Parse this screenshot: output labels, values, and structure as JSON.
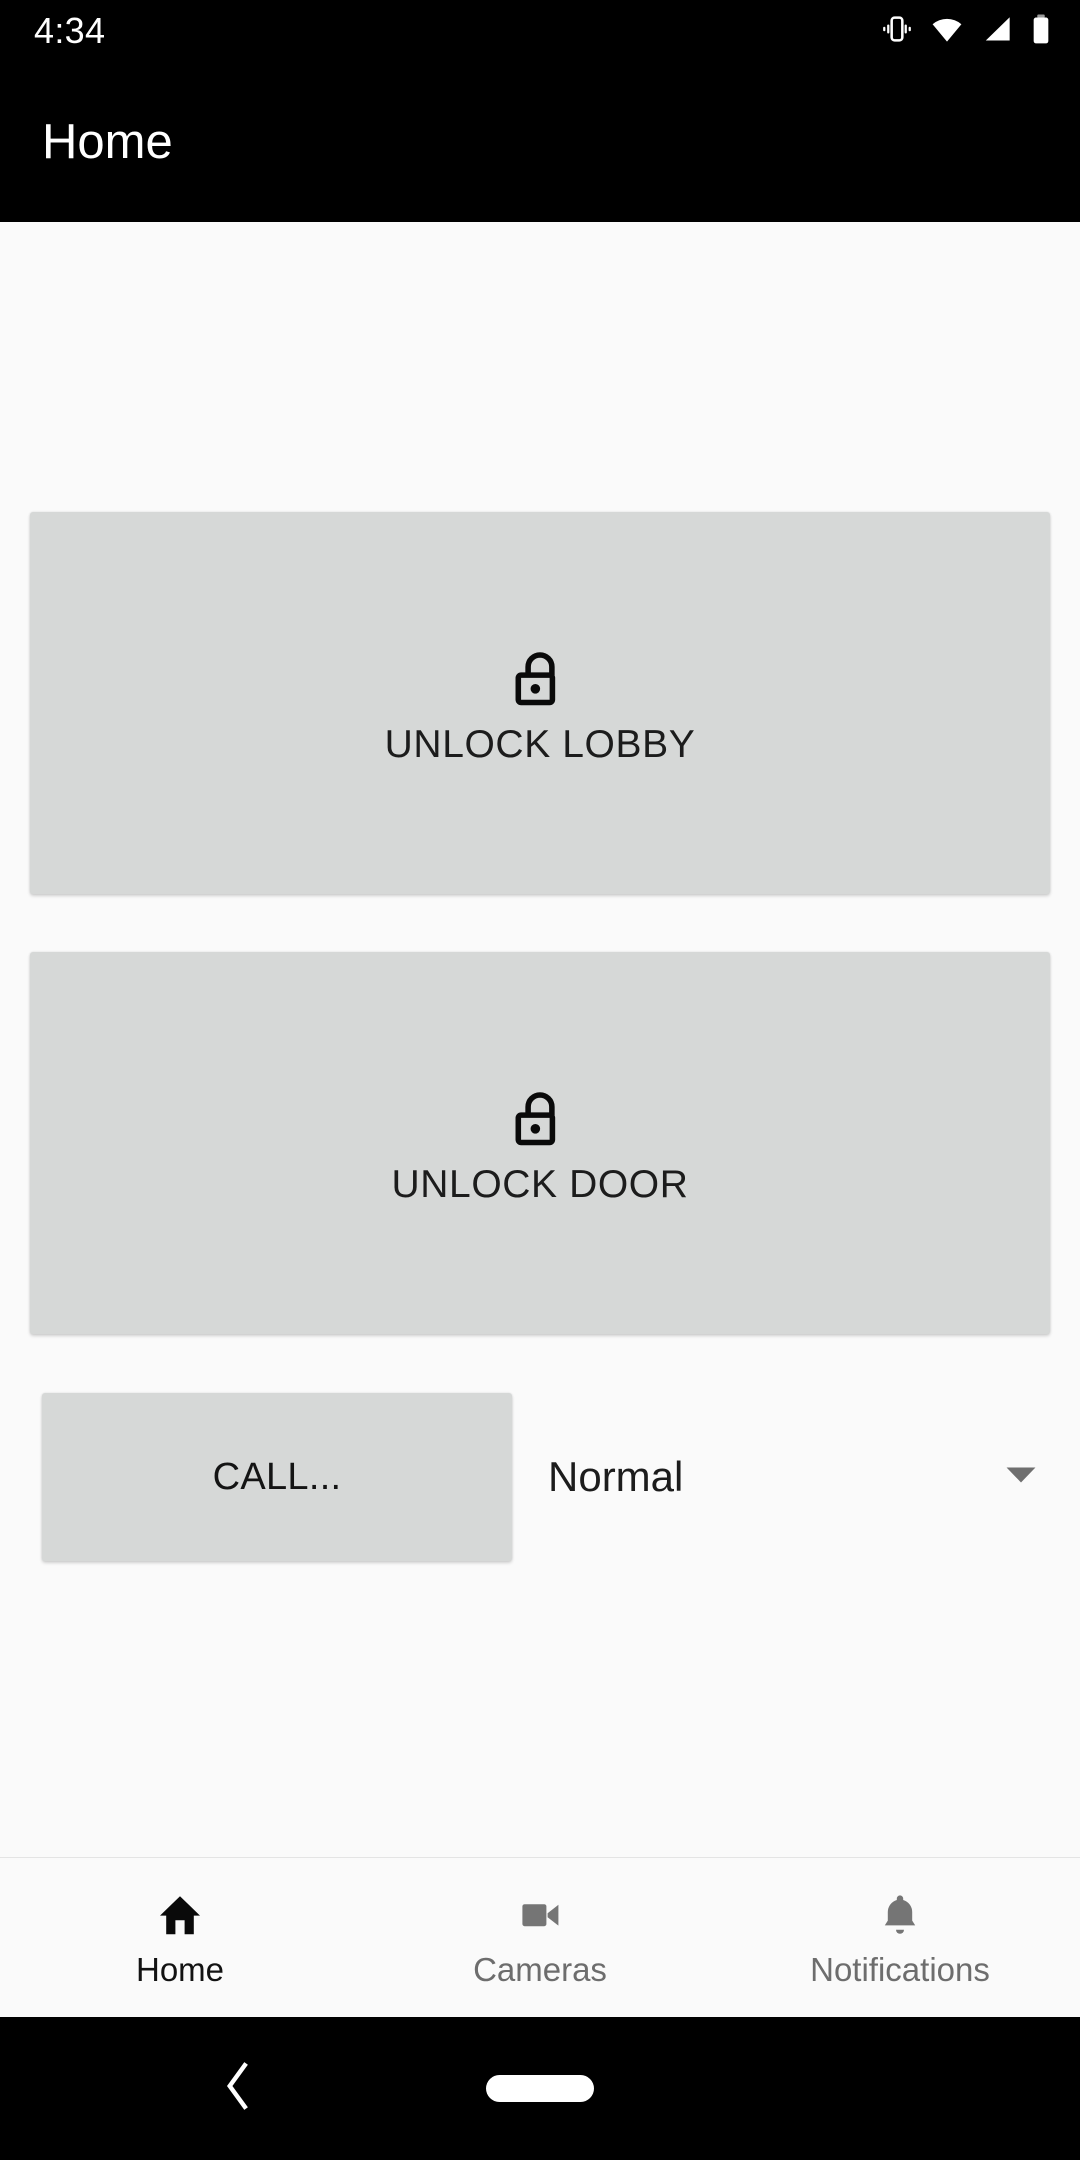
{
  "status_bar": {
    "time": "4:34",
    "icons": [
      {
        "name": "vibrate-icon",
        "label": "vibrate"
      },
      {
        "name": "wifi-icon",
        "label": "wifi-full"
      },
      {
        "name": "cellular-signal-icon",
        "label": "cellular-signal"
      },
      {
        "name": "battery-icon",
        "label": "battery"
      }
    ]
  },
  "app_bar": {
    "title": "Home"
  },
  "main": {
    "cards": [
      {
        "id": "lobby",
        "label": "UNLOCK LOBBY",
        "icon": "unlock-icon"
      },
      {
        "id": "door",
        "label": "UNLOCK DOOR",
        "icon": "unlock-icon"
      }
    ],
    "call_button": {
      "label": "CALL..."
    },
    "mode_spinner": {
      "value": "Normal",
      "caret": "chevron-down-icon"
    }
  },
  "bottom_nav": {
    "items": [
      {
        "id": "home",
        "label": "Home",
        "icon": "home-icon",
        "active": true
      },
      {
        "id": "cameras",
        "label": "Cameras",
        "icon": "video-camera-icon",
        "active": false
      },
      {
        "id": "notifications",
        "label": "Notifications",
        "icon": "bell-icon",
        "active": false
      }
    ]
  },
  "system_nav": {
    "back": "back-chevron-icon",
    "home": "home-pill-handle"
  },
  "colors": {
    "system_bar_bg": "#000000",
    "page_bg": "#fafafa",
    "card_bg": "#d6d8d7",
    "text_primary": "#1c1c1c",
    "text_muted": "#6d6d6d",
    "on_dark": "#ffffff"
  }
}
